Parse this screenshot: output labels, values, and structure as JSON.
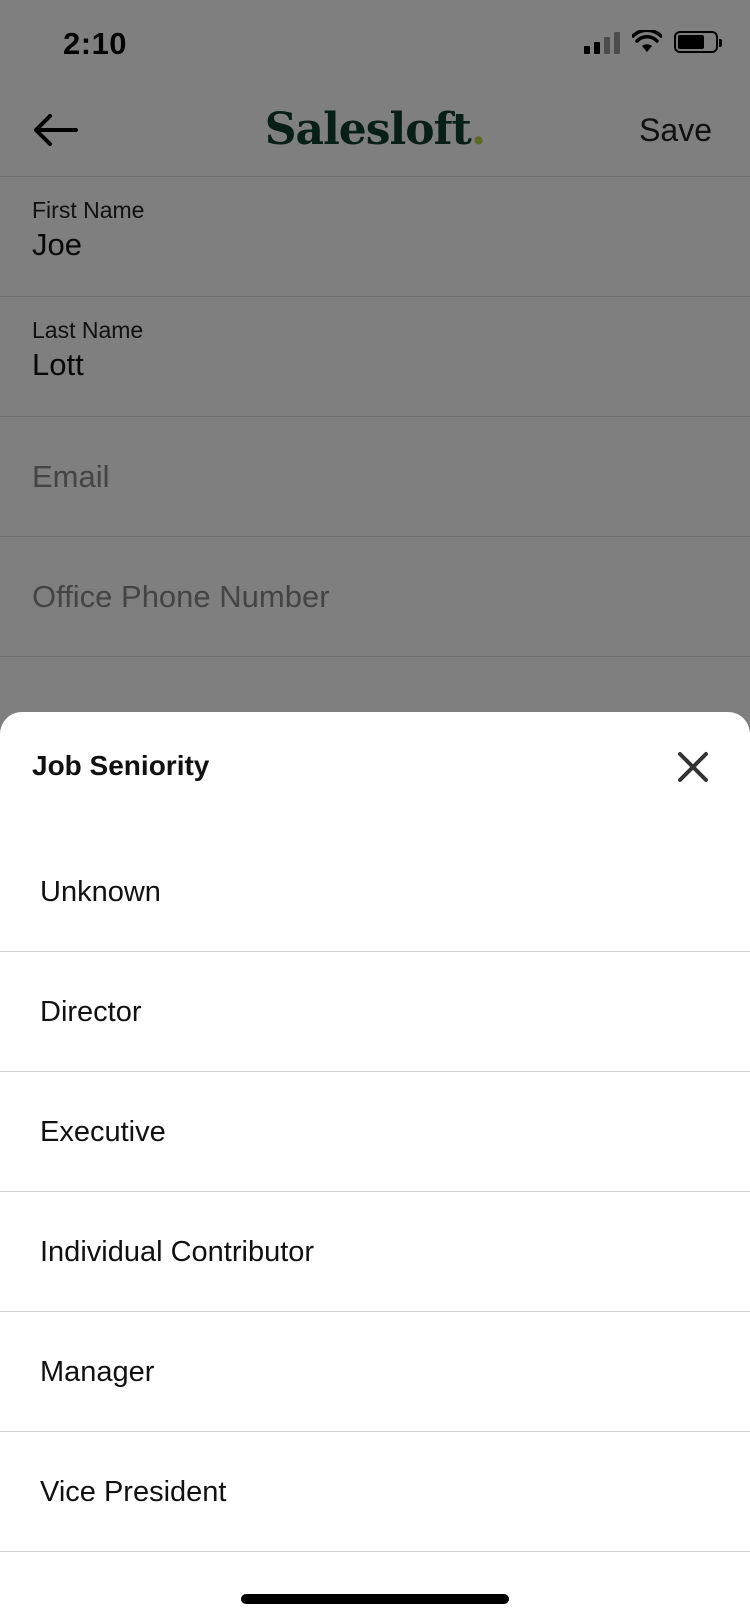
{
  "status_bar": {
    "time": "2:10"
  },
  "nav": {
    "logo": "Salesloft",
    "logo_dot": ".",
    "save_label": "Save"
  },
  "form": {
    "first_name": {
      "label": "First Name",
      "value": "Joe"
    },
    "last_name": {
      "label": "Last Name",
      "value": "Lott"
    },
    "email": {
      "placeholder": "Email"
    },
    "office_phone": {
      "placeholder": "Office Phone Number"
    }
  },
  "sheet": {
    "title": "Job Seniority",
    "options": [
      {
        "label": "Unknown"
      },
      {
        "label": "Director"
      },
      {
        "label": "Executive"
      },
      {
        "label": "Individual Contributor"
      },
      {
        "label": "Manager"
      },
      {
        "label": "Vice President"
      }
    ]
  },
  "colors": {
    "brand": "#0f3e2c",
    "brand_dot": "#b9d24b",
    "overlay": "rgba(0,0,0,0.5)"
  },
  "icons": [
    "back-arrow-icon",
    "signal-icon",
    "wifi-icon",
    "battery-icon",
    "close-icon"
  ]
}
